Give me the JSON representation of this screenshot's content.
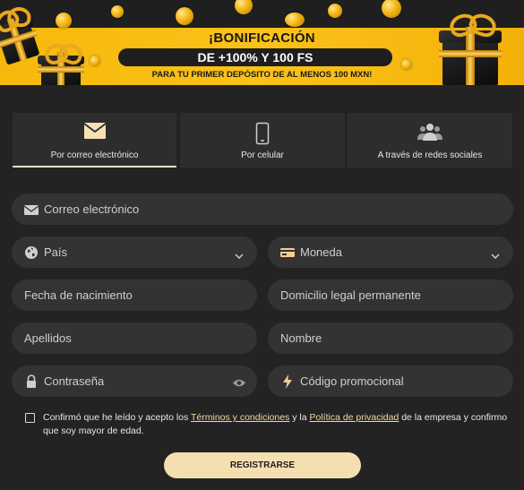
{
  "banner": {
    "title": "¡BONIFICACIÓN",
    "offer": "DE +100% Y 100 FS",
    "subtitle": "PARA TU PRIMER DEPÓSITO DE AL MENOS 100 MXN!"
  },
  "tabs": [
    {
      "label": "Por correo electrónico",
      "icon": "envelope-icon",
      "active": true
    },
    {
      "label": "Por celular",
      "icon": "phone-icon",
      "active": false
    },
    {
      "label": "A través de redes sociales",
      "icon": "users-icon",
      "active": false
    }
  ],
  "form": {
    "email": {
      "placeholder": "Correo electrónico",
      "icon": "envelope-icon"
    },
    "country": {
      "placeholder": "País",
      "icon": "globe-icon"
    },
    "currency": {
      "placeholder": "Moneda",
      "icon": "banknote-icon"
    },
    "birthdate": {
      "placeholder": "Fecha de nacimiento"
    },
    "address": {
      "placeholder": "Domicilio legal permanente"
    },
    "surname": {
      "placeholder": "Apellidos"
    },
    "name": {
      "placeholder": "Nombre"
    },
    "password": {
      "placeholder": "Contraseña",
      "icon": "lock-icon"
    },
    "promo": {
      "placeholder": "Código promocional",
      "icon": "lightning-icon"
    }
  },
  "consent": {
    "part1": "Confirmó que he leído y acepto los ",
    "terms_link": "Términos y condiciones",
    "part2": " y la ",
    "privacy_link": "Política de privacidad",
    "part3": " de la empresa y confirmo que soy mayor de edad."
  },
  "register_label": "REGISTRARSE",
  "colors": {
    "accent": "#f5dfb0",
    "banner": "#fbc21a",
    "background": "#232323",
    "field": "#333333"
  }
}
